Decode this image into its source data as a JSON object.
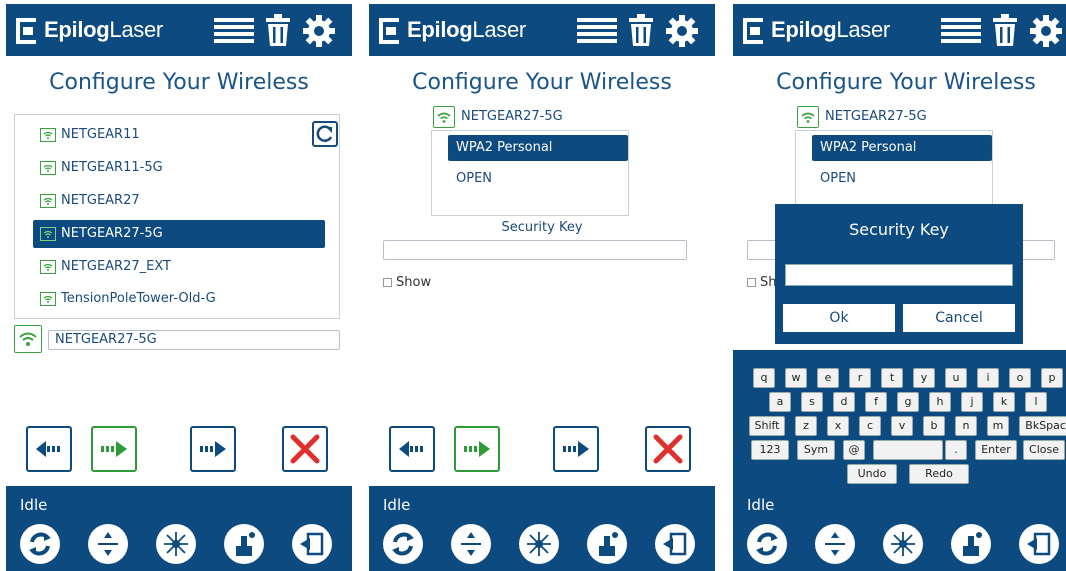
{
  "app": {
    "brand_bold": "Epilog",
    "brand_light": "Laser"
  },
  "colors": {
    "primary": "#0c4a7f",
    "green": "#2e9b37",
    "red": "#e02d2d",
    "white": "#ffffff"
  },
  "panel1": {
    "title": "Configure Your Wireless",
    "networks": [
      "NETGEAR11",
      "NETGEAR11-5G",
      "NETGEAR27",
      "NETGEAR27-5G",
      "NETGEAR27_EXT",
      "TensionPoleTower-Old-G"
    ],
    "selected_network": "NETGEAR27-5G",
    "network_field_value": "NETGEAR27-5G",
    "status": "Idle"
  },
  "panel2": {
    "title": "Configure Your Wireless",
    "current_network": "NETGEAR27-5G",
    "security_options": [
      "WPA2 Personal",
      "OPEN"
    ],
    "security_selected": "WPA2 Personal",
    "security_key_label": "Security Key",
    "security_key_value": "",
    "show_label": "Show",
    "status": "Idle"
  },
  "panel3": {
    "title": "Configure Your Wireless",
    "current_network": "NETGEAR27-5G",
    "security_options": [
      "WPA2 Personal",
      "OPEN"
    ],
    "show_label_partial": "Sh",
    "dialog": {
      "title": "Security Key",
      "value": "",
      "ok": "Ok",
      "cancel": "Cancel"
    },
    "keyboard": {
      "row1": [
        "q",
        "w",
        "e",
        "r",
        "t",
        "y",
        "u",
        "i",
        "o",
        "p"
      ],
      "row2": [
        "a",
        "s",
        "d",
        "f",
        "g",
        "h",
        "j",
        "k",
        "l"
      ],
      "row3": [
        "Shift",
        "z",
        "x",
        "c",
        "v",
        "b",
        "n",
        "m",
        "BkSpace"
      ],
      "row4": [
        "123",
        "Sym",
        "@",
        "",
        ".",
        "Enter",
        "Close"
      ],
      "row5": [
        "Undo",
        "Redo"
      ]
    },
    "status": "Idle"
  },
  "icons": {
    "header": [
      "list-icon",
      "trash-icon",
      "gear-icon"
    ],
    "footer": [
      "refresh-icon",
      "move-icon",
      "laser-icon",
      "job-icon",
      "exit-icon"
    ],
    "nav": [
      "back-arrow-icon",
      "green-next-icon",
      "forward-arrow-icon",
      "close-x-icon"
    ]
  }
}
